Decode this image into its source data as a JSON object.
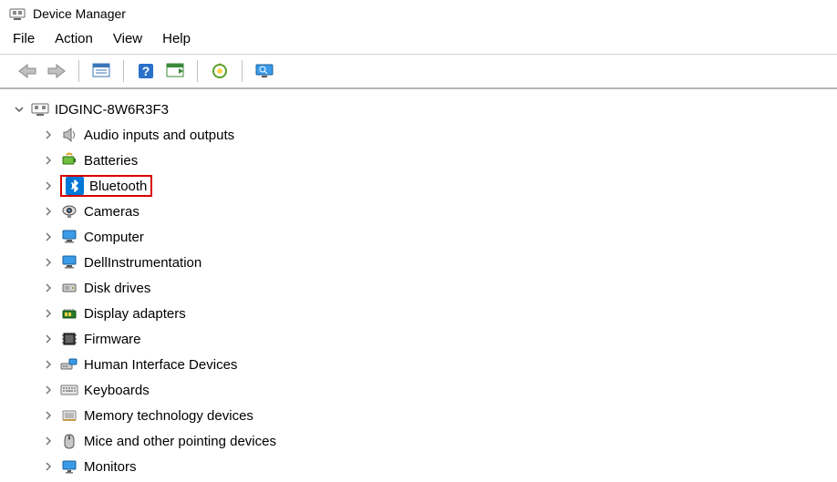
{
  "window": {
    "title": "Device Manager"
  },
  "menubar": {
    "file": "File",
    "action": "Action",
    "view": "View",
    "help": "Help"
  },
  "toolbar_icons": {
    "back": "back-arrow-icon",
    "forward": "forward-arrow-icon",
    "properties": "properties-icon",
    "help": "help-icon",
    "scan": "scan-icon",
    "update": "update-driver-icon",
    "monitor": "monitor-icon"
  },
  "tree": {
    "root": {
      "label": "IDGINC-8W6R3F3",
      "expanded": true
    },
    "children": [
      {
        "label": "Audio inputs and outputs",
        "icon": "speaker-icon"
      },
      {
        "label": "Batteries",
        "icon": "battery-icon"
      },
      {
        "label": "Bluetooth",
        "icon": "bluetooth-icon",
        "highlighted": true
      },
      {
        "label": "Cameras",
        "icon": "camera-icon"
      },
      {
        "label": "Computer",
        "icon": "computer-icon"
      },
      {
        "label": "DellInstrumentation",
        "icon": "dell-icon"
      },
      {
        "label": "Disk drives",
        "icon": "disk-icon"
      },
      {
        "label": "Display adapters",
        "icon": "display-icon"
      },
      {
        "label": "Firmware",
        "icon": "firmware-icon"
      },
      {
        "label": "Human Interface Devices",
        "icon": "hid-icon"
      },
      {
        "label": "Keyboards",
        "icon": "keyboard-icon"
      },
      {
        "label": "Memory technology devices",
        "icon": "memory-icon"
      },
      {
        "label": "Mice and other pointing devices",
        "icon": "mouse-icon"
      },
      {
        "label": "Monitors",
        "icon": "monitor-device-icon"
      }
    ]
  }
}
